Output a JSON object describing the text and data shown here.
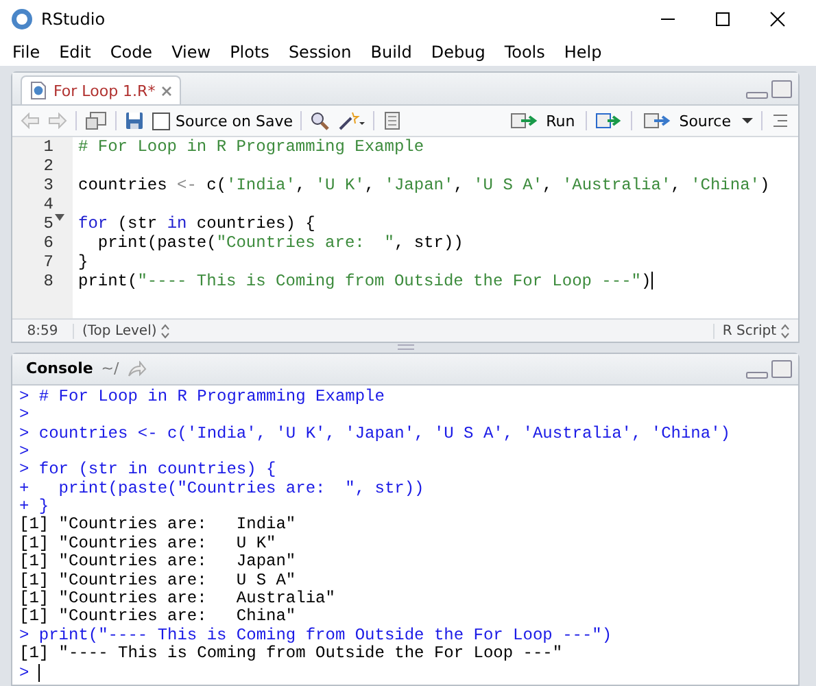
{
  "window": {
    "title": "RStudio"
  },
  "menu": [
    "File",
    "Edit",
    "Code",
    "View",
    "Plots",
    "Session",
    "Build",
    "Debug",
    "Tools",
    "Help"
  ],
  "editor": {
    "tabs": [
      {
        "label": "For Loop 1.R*",
        "selected": true,
        "modified": true
      }
    ],
    "toolbar": {
      "source_on_save": {
        "label": "Source on Save",
        "checked": false
      },
      "run": "Run",
      "source": "Source"
    },
    "lines": [
      {
        "number": "1",
        "tokens": [
          {
            "kind": "comment",
            "text": "# For Loop in R Programming Example"
          }
        ]
      },
      {
        "number": "2"
      },
      {
        "number": "3",
        "tokens": [
          {
            "kind": "plain",
            "text": "countries "
          },
          {
            "kind": "operator",
            "text": "<-"
          },
          {
            "kind": "plain",
            "text": " c("
          },
          {
            "kind": "string",
            "text": "'India'"
          },
          {
            "kind": "plain",
            "text": ", "
          },
          {
            "kind": "string",
            "text": "'U K'"
          },
          {
            "kind": "plain",
            "text": ", "
          },
          {
            "kind": "string",
            "text": "'Japan'"
          },
          {
            "kind": "plain",
            "text": ", "
          },
          {
            "kind": "string",
            "text": "'U S A'"
          },
          {
            "kind": "plain",
            "text": ", "
          },
          {
            "kind": "string",
            "text": "'Australia'"
          },
          {
            "kind": "plain",
            "text": ", "
          },
          {
            "kind": "string",
            "text": "'China'"
          },
          {
            "kind": "plain",
            "text": ")"
          }
        ]
      },
      {
        "number": "4"
      },
      {
        "number": "5",
        "foldable": true,
        "tokens": [
          {
            "kind": "keyword",
            "text": "for"
          },
          {
            "kind": "plain",
            "text": " (str "
          },
          {
            "kind": "keyword",
            "text": "in"
          },
          {
            "kind": "plain",
            "text": " countries) {"
          }
        ]
      },
      {
        "number": "6",
        "tokens": [
          {
            "kind": "plain",
            "text": "  print(paste("
          },
          {
            "kind": "string",
            "text": "\"Countries are:  \""
          },
          {
            "kind": "plain",
            "text": ", str))"
          }
        ]
      },
      {
        "number": "7",
        "tokens": [
          {
            "kind": "plain",
            "text": "}"
          }
        ]
      },
      {
        "number": "8",
        "cursor": true,
        "tokens": [
          {
            "kind": "plain",
            "text": "print("
          },
          {
            "kind": "string",
            "text": "\"---- This is Coming from Outside the For Loop ---\""
          },
          {
            "kind": "plain",
            "text": ")"
          }
        ]
      }
    ],
    "status": {
      "position": "8:59",
      "scope": "(Top Level)",
      "file_type": "R Script"
    }
  },
  "console": {
    "title": "Console",
    "path": "~/",
    "lines": [
      {
        "kind": "input",
        "text": "> # For Loop in R Programming Example"
      },
      {
        "kind": "input",
        "text": ">"
      },
      {
        "kind": "input",
        "text": "> countries <- c('India', 'U K', 'Japan', 'U S A', 'Australia', 'China')"
      },
      {
        "kind": "input",
        "text": ">"
      },
      {
        "kind": "input",
        "text": "> for (str in countries) {"
      },
      {
        "kind": "input",
        "text": "+   print(paste(\"Countries are:  \", str))"
      },
      {
        "kind": "input",
        "text": "+ }"
      },
      {
        "kind": "output",
        "text": "[1] \"Countries are:   India\""
      },
      {
        "kind": "output",
        "text": "[1] \"Countries are:   U K\""
      },
      {
        "kind": "output",
        "text": "[1] \"Countries are:   Japan\""
      },
      {
        "kind": "output",
        "text": "[1] \"Countries are:   U S A\""
      },
      {
        "kind": "output",
        "text": "[1] \"Countries are:   Australia\""
      },
      {
        "kind": "output",
        "text": "[1] \"Countries are:   China\""
      },
      {
        "kind": "input",
        "text": "> print(\"---- This is Coming from Outside the For Loop ---\")"
      },
      {
        "kind": "output",
        "text": "[1] \"---- This is Coming from Outside the For Loop ---\""
      },
      {
        "kind": "prompt",
        "text": ">"
      }
    ]
  }
}
